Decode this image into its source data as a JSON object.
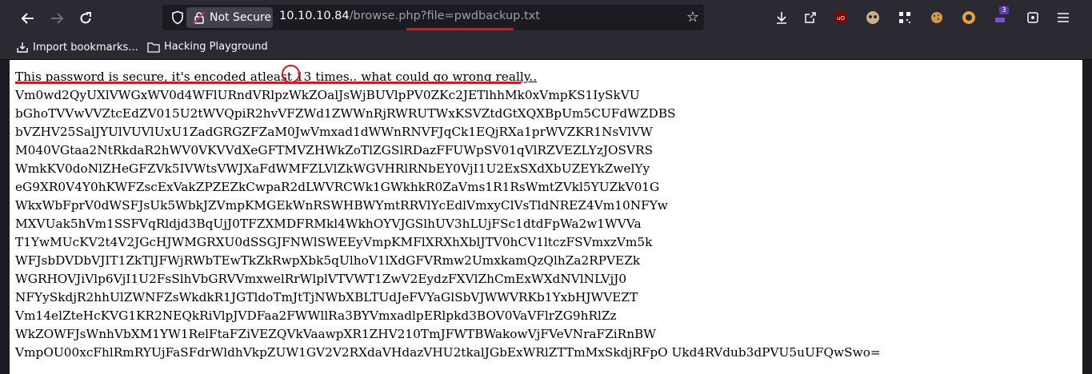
{
  "browser": {
    "security_label": "Not Secure",
    "url_host": "10.10.10.84",
    "url_path": "/browse.php?",
    "url_query": "file=pwdbackup.txt",
    "extension_badge": "3"
  },
  "bookmarks": [
    {
      "label": "Import bookmarks...",
      "icon": "import-icon"
    },
    {
      "label": "Hacking Playground",
      "icon": "folder-icon"
    }
  ],
  "page": {
    "headline": "This password is secure, it's encoded atleast 13 times.. what could go wrong really..",
    "encoded_lines": [
      "Vm0wd2QyUXlVWGxWV0d4WFlURndVRlpzWkZOalJsWjBUVlpPV0ZKc2JETlhhMk0xVmpKS1IySkVU",
      "bGhoTVVwVVZtcEdZV015U2tWVQpiR2hvVFZWd1ZWWnRjRWRUTWxKSVZtdGtXQXBpUm5CUFdWZDBS",
      "bVZHV25SalJYUlVUVlUxU1ZadGRGZFZaM0JwVmxad1dWWnRNVFJqCk1EQjRXa1prWVZKR1NsVlVW",
      "M040VGtaa2NtRkdaR2hWV0VKVVdXeGFTMVZHWkZoTlZGSlRDazFFUWpSV01qVlRZVEZLYzJOSVRS",
      "WmkKV0doNlZHeGFZVk5IVWtsVWJXaFdWMFZLVlZkWGVHRlRNbEY0VjI1U2ExSXdXbUZEYkZwelYy",
      "eG9XR0V4Y0hKWFZscExVakZPZEZkCwpaR2dLWVRCWk1GWkhkR0ZaVms1R1RsWmtZVkl5YUZkV01G",
      "WkxWbFprV0dWSFJsUk5WbkJZVmpKMGEkWnRSWHBWYmtRRVlYcEdlVmxyClVsTldNREZ4Vm10NFYw",
      "MXVUak5hVm1SSFVqRldjd3BqUjJ0TFZXMDFRMkl4WkhOYVJGSlhUV3hLUjFSc1dtdFpWa2w1WVVa",
      "T1YwMUcKV2t4V2JGcHJWMGRXU0dSSGJFNWlSWEEyVmpKMFlXRXhXblJTV0hCV1ltczFSVmxzVm5k",
      "WFJsbDVDbVJIT1ZkTlJFWjRWbTEwTkZkRwpXbk5qUlhoV1lXdGFVRmw2UmxkamQzQlhZa2RPVEZk",
      "WGRHOVJiVlp6VjI1U2FsSlhVbGRVVmxwelRrWlplVTVWT1ZwV2EydzFXVlZhCmExWXdNVlNLVjJ0",
      "NFYySkdjR2hhUlZWNFZsWkdkR1JGTldoTmJtTjNWbXBLTUdJeFVYaGlSbVJWWVRKb1YxbHJWVEZT",
      "Vm14elZteHcKVG1KR2NEQkRiVlpJVDFaa2FWWllRa3BYVmxadlpERlpkd3BOV0VaVFlrZG9hRlZz",
      "WkZOWFJsWnhVbXM1YW1RelFtaFZiVEZQVkVaawpXR1ZHV210TmJFWTBWakowVjFVeVNraFZiRnBW",
      "VmpOU00xcFhlRmRYUjFaSFdrWldhVkpZUW1GV2V2RXdaVHdazVHU2tkalJGbExWRlZTTmMxSkdjRFpO Ukd4RVdub3dPVU5uUFQwSwo="
    ]
  }
}
